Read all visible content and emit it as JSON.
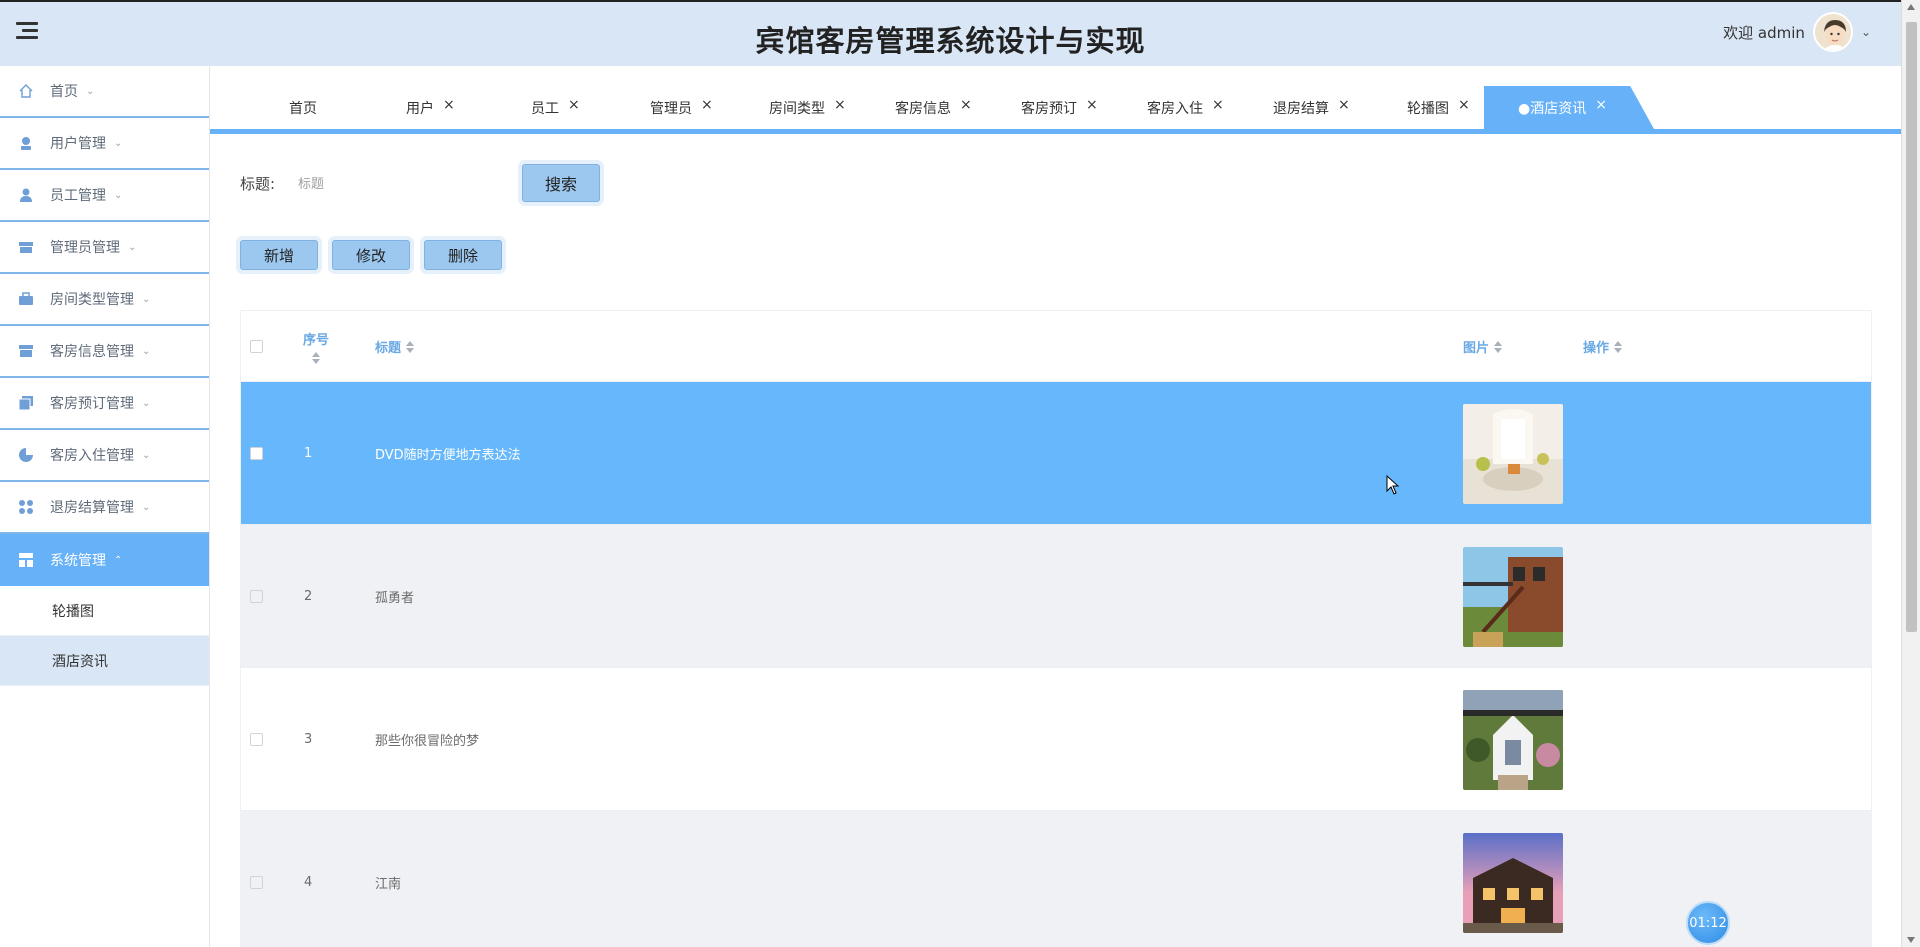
{
  "header": {
    "title": "宾馆客房管理系统设计与实现",
    "welcome": "欢迎 admin"
  },
  "sidebar": {
    "items": [
      {
        "label": "首页",
        "icon": "home-icon"
      },
      {
        "label": "用户管理",
        "icon": "user-icon"
      },
      {
        "label": "员工管理",
        "icon": "person-icon"
      },
      {
        "label": "管理员管理",
        "icon": "store-icon"
      },
      {
        "label": "房间类型管理",
        "icon": "briefcase-icon"
      },
      {
        "label": "客房信息管理",
        "icon": "archive-icon"
      },
      {
        "label": "客房预订管理",
        "icon": "copy-icon"
      },
      {
        "label": "客房入住管理",
        "icon": "pie-icon"
      },
      {
        "label": "退房结算管理",
        "icon": "grid-icon"
      },
      {
        "label": "系统管理",
        "icon": "layout-icon"
      }
    ],
    "subitems": [
      {
        "label": "轮播图"
      },
      {
        "label": "酒店资讯"
      }
    ]
  },
  "tabs": [
    {
      "label": "首页"
    },
    {
      "label": "用户"
    },
    {
      "label": "员工"
    },
    {
      "label": "管理员"
    },
    {
      "label": "房间类型"
    },
    {
      "label": "客房信息"
    },
    {
      "label": "客房预订"
    },
    {
      "label": "客房入住"
    },
    {
      "label": "退房结算"
    },
    {
      "label": "轮播图"
    },
    {
      "label": "●酒店资讯"
    }
  ],
  "search": {
    "label": "标题:",
    "placeholder": "标题",
    "button": "搜索"
  },
  "actions": {
    "add": "新增",
    "edit": "修改",
    "delete": "删除"
  },
  "table": {
    "columns": {
      "index": "序号",
      "title": "标题",
      "image": "图片",
      "ops": "操作"
    },
    "rows": [
      {
        "index": "1",
        "title": "DVD随时方便地方表达法"
      },
      {
        "index": "2",
        "title": "孤勇者"
      },
      {
        "index": "3",
        "title": "那些你很冒险的梦"
      },
      {
        "index": "4",
        "title": "江南"
      }
    ]
  },
  "timer": "01:12",
  "colors": {
    "accent": "#66b1f7",
    "header_bg": "#d9e6f5",
    "selected_row": "#66b7fb"
  }
}
